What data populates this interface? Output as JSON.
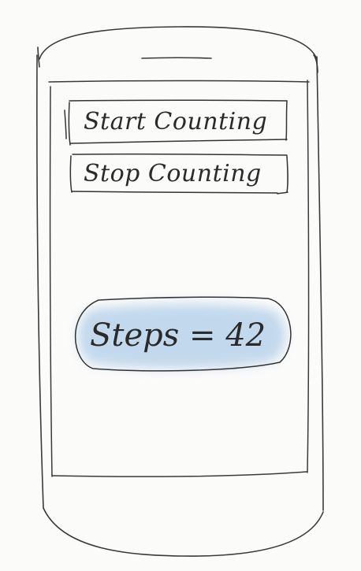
{
  "buttons": {
    "start_label": "Start Counting",
    "stop_label": "Stop Counting"
  },
  "counter": {
    "label": "Steps = 42"
  },
  "colors": {
    "ink": "#2b2b2b",
    "highlight": "#b9d3ea",
    "paper": "#fbfbfa"
  }
}
